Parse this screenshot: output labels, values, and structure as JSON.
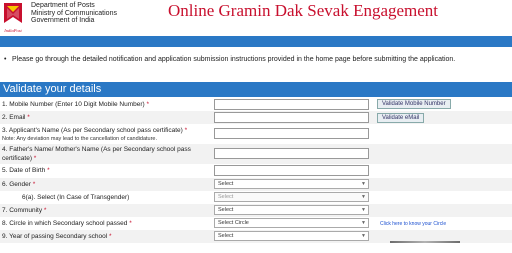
{
  "header": {
    "org_lines": [
      "Department of Posts",
      "Ministry of Communications",
      "Government of India"
    ],
    "logo_text": "IndiaPost",
    "title": "Online Gramin Dak Sevak Engagement"
  },
  "notice": {
    "text": "Please go through the detailed notification and application submission instructions provided in the home page before submitting the application."
  },
  "form": {
    "section_title": "Validate your details",
    "fields": {
      "mobile": {
        "label": "1. Mobile Number (Enter 10 Digit Mobile Number)",
        "required": "*",
        "button": "Validate Mobile Number"
      },
      "email": {
        "label": "2. Email",
        "required": "*",
        "button": "Validate eMail"
      },
      "applicant_name": {
        "label": "3. Applicant's Name (As per Secondary school pass certificate)",
        "required": "*",
        "note": "Note: Any deviation may lead to the cancellation of candidature."
      },
      "parent_name": {
        "label_line1": "4. Father's Name/ Mother's Name (As per Secondary school pass",
        "label_line2": "certificate)",
        "required": "*"
      },
      "dob": {
        "label": "5. Date of Birth",
        "required": "*"
      },
      "gender": {
        "label": "6. Gender",
        "required": "*",
        "selected": "Select"
      },
      "transgender": {
        "label": "6(a). Select (In Case of Transgender)",
        "selected": "Select"
      },
      "community": {
        "label": "7. Community",
        "required": "*",
        "selected": "Select"
      },
      "circle": {
        "label": "8. Circle in which Secondary school passed",
        "required": "*",
        "selected": "Select Circle",
        "link": "Click here to know your Circle"
      },
      "year": {
        "label": "9. Year of passing Secondary school",
        "required": "*",
        "selected": "Select"
      }
    }
  },
  "colors": {
    "brand_red": "#c8102e",
    "band_blue": "#2a78c5"
  },
  "icons": {
    "logo": "india-post-logo-icon",
    "dropdown": "chevron-down-icon"
  }
}
